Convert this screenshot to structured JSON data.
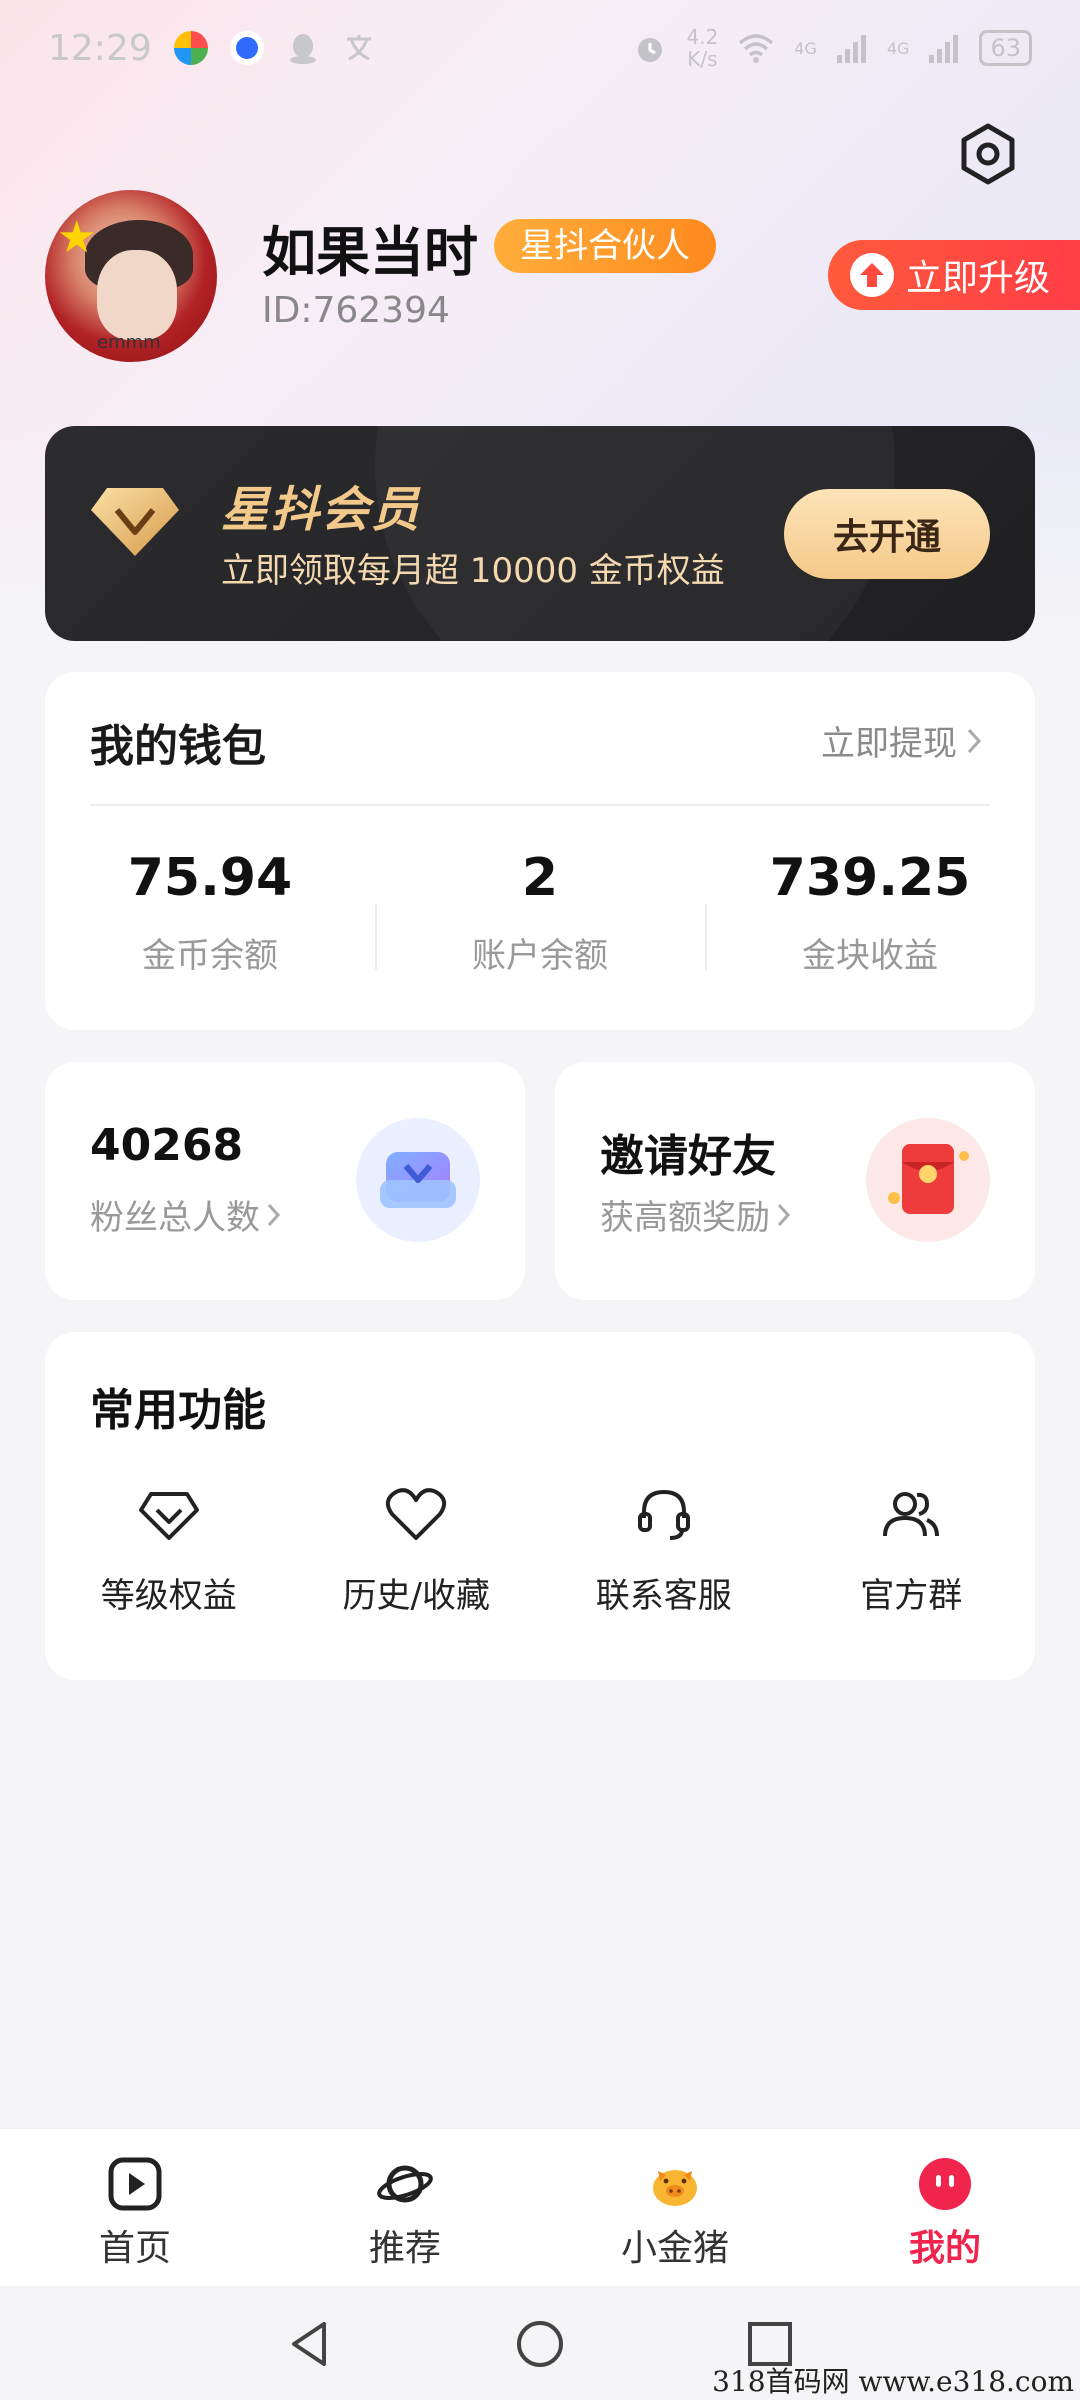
{
  "status_bar": {
    "time": "12:29",
    "net_speed_value": "4.2",
    "net_speed_unit": "K/s",
    "signal_1": "4G",
    "signal_2": "4G",
    "battery": "63"
  },
  "profile": {
    "username": "如果当时",
    "badge": "星抖合伙人",
    "user_id": "ID:762394",
    "avatar_caption": "emmm",
    "upgrade_label": "立即升级"
  },
  "vip": {
    "title": "星抖会员",
    "subtitle": "立即领取每月超 10000 金币权益",
    "button_label": "去开通"
  },
  "wallet": {
    "title": "我的钱包",
    "withdraw_label": "立即提现",
    "stats": [
      {
        "value": "75.94",
        "label": "金币余额"
      },
      {
        "value": "2",
        "label": "账户余额"
      },
      {
        "value": "739.25",
        "label": "金块收益"
      }
    ]
  },
  "fans_card": {
    "title": "40268",
    "subtitle": "粉丝总人数"
  },
  "invite_card": {
    "title": "邀请好友",
    "subtitle": "获高额奖励"
  },
  "functions": {
    "title": "常用功能",
    "items": [
      {
        "label": "等级权益",
        "icon": "diamond-icon"
      },
      {
        "label": "历史/收藏",
        "icon": "heart-icon"
      },
      {
        "label": "联系客服",
        "icon": "headset-icon"
      },
      {
        "label": "官方群",
        "icon": "group-icon"
      }
    ]
  },
  "tabbar": {
    "items": [
      {
        "label": "首页",
        "icon": "play-icon"
      },
      {
        "label": "推荐",
        "icon": "planet-icon"
      },
      {
        "label": "小金猪",
        "icon": "piggy-icon"
      },
      {
        "label": "我的",
        "icon": "profile-icon"
      }
    ],
    "active_index": 3
  },
  "watermark": "318首码网 www.e318.com",
  "colors": {
    "accent": "#f0244d",
    "badge": "#ff9a2a",
    "upgrade": "#ff4a40",
    "vip_gold": "#f2c98a"
  }
}
